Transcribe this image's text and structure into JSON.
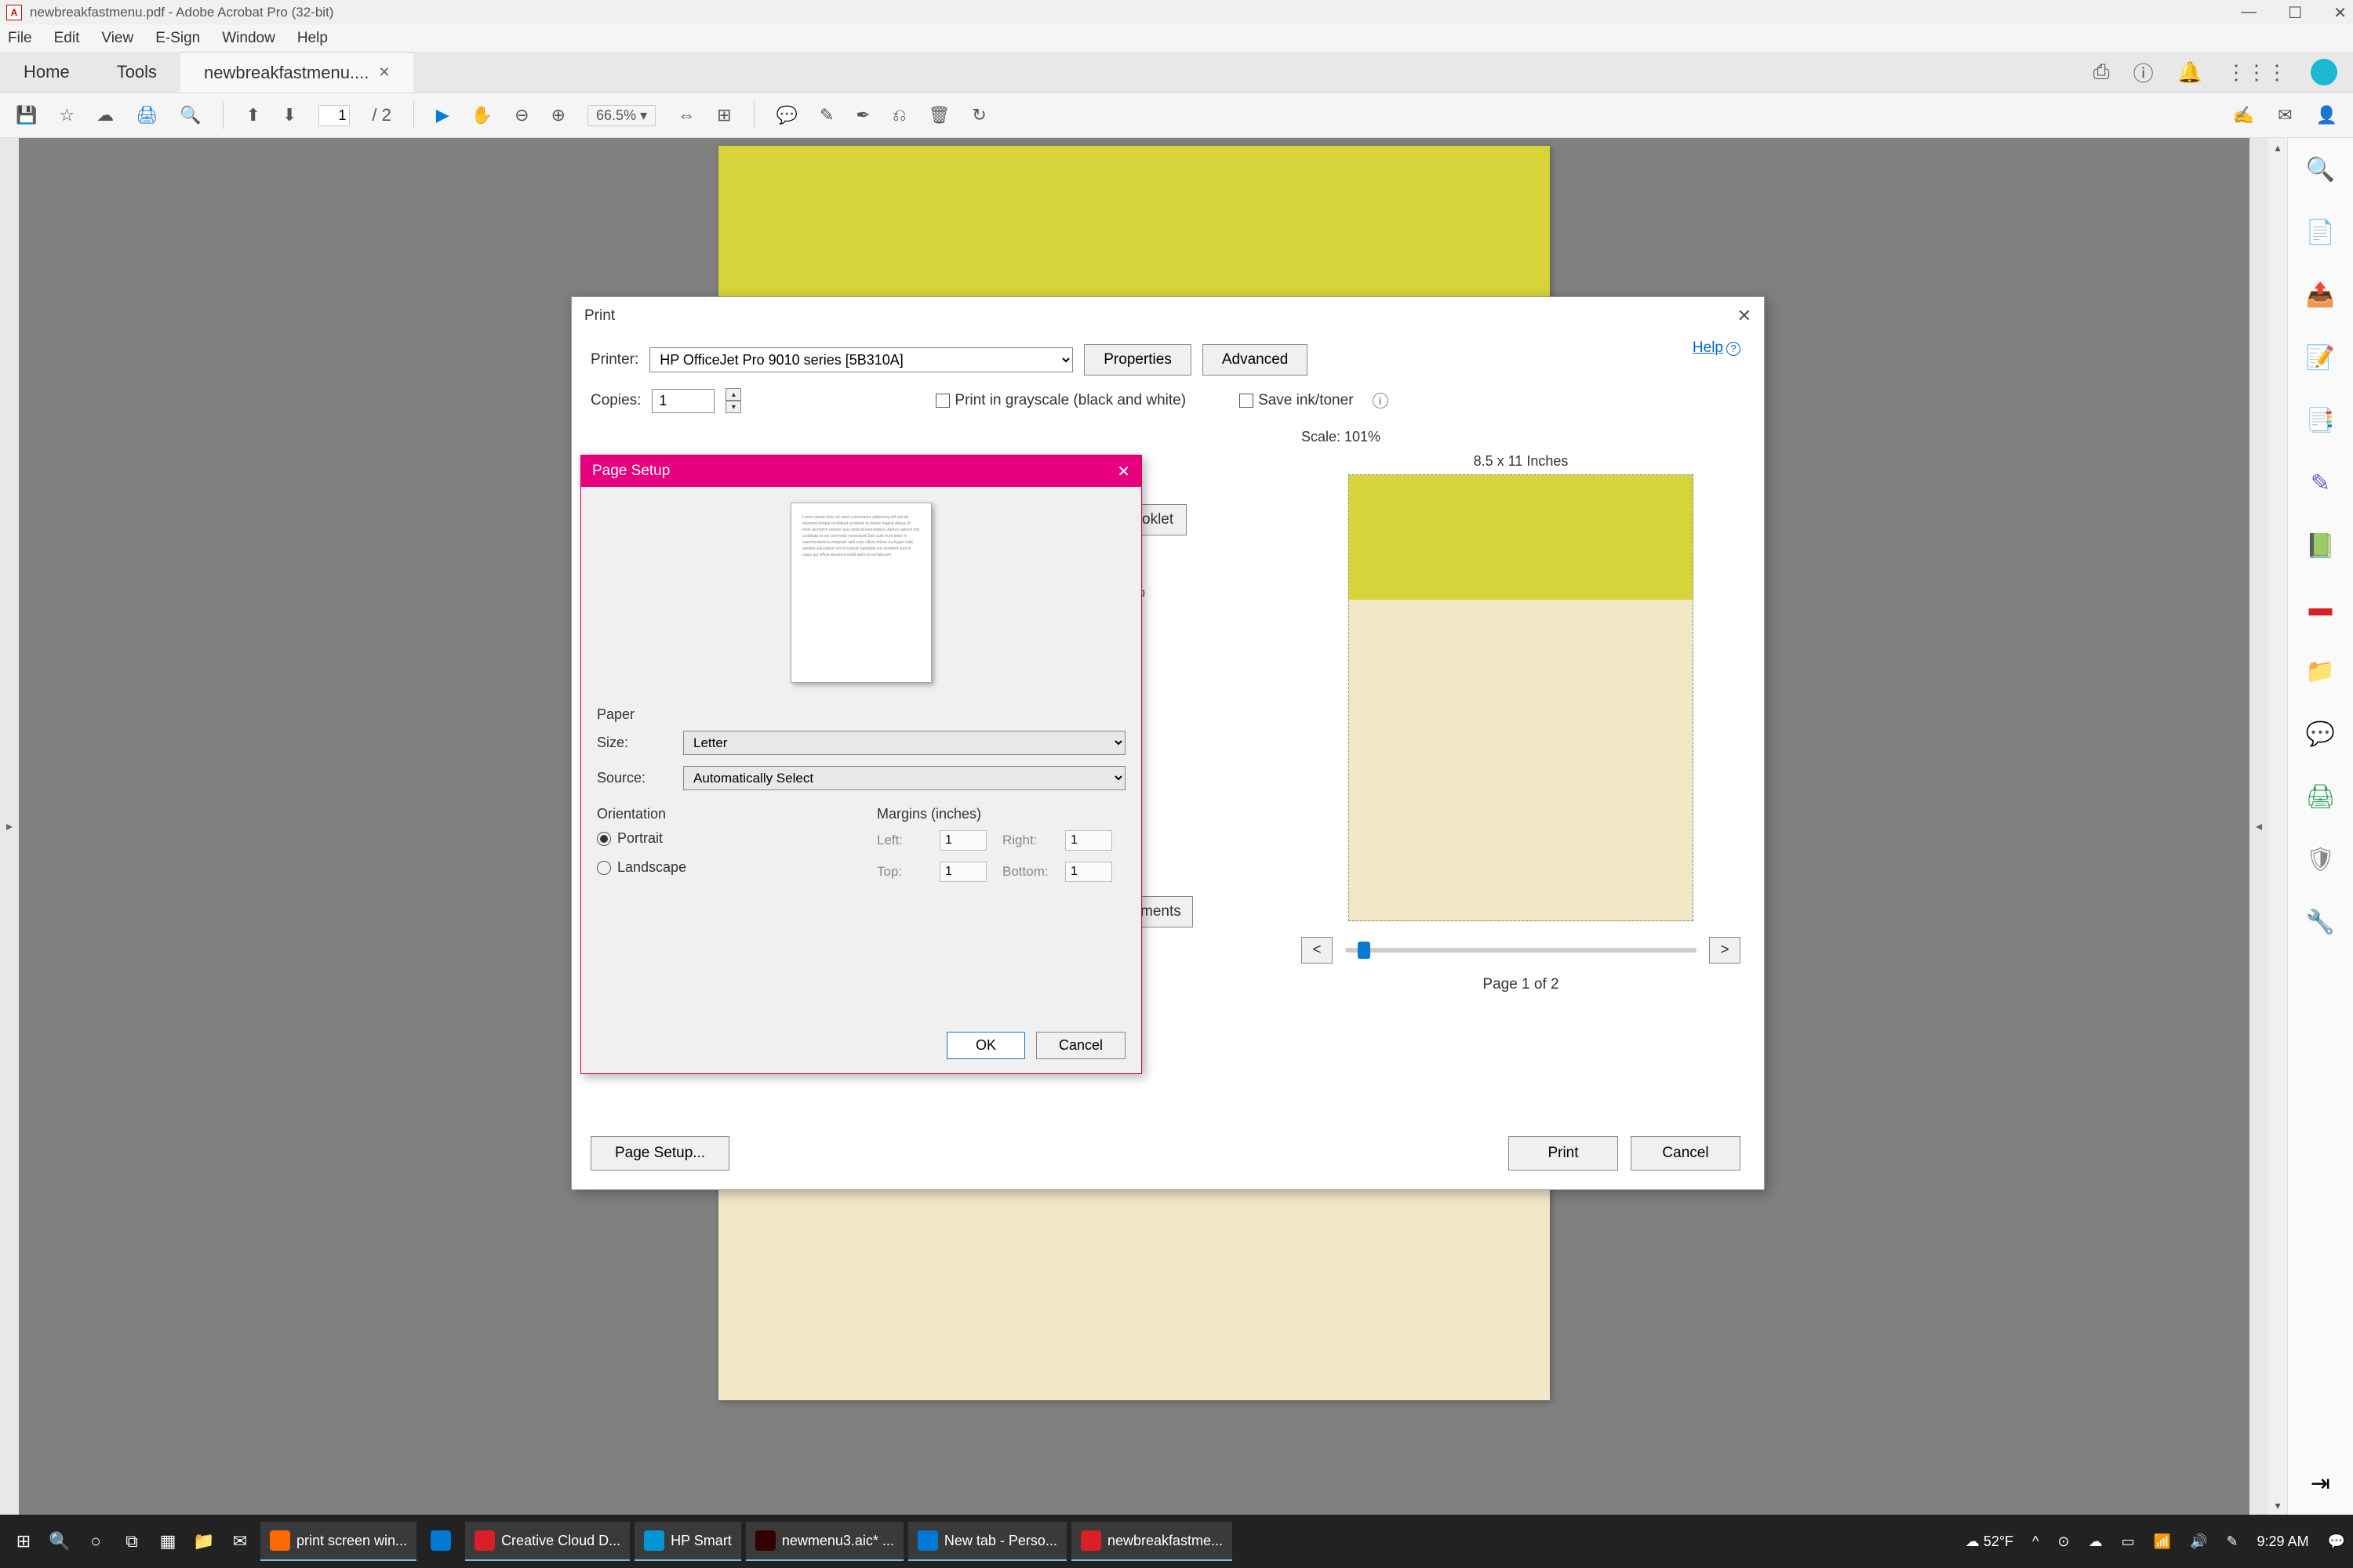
{
  "titlebar": {
    "text": "newbreakfastmenu.pdf - Adobe Acrobat Pro (32-bit)"
  },
  "menubar": {
    "items": [
      "File",
      "Edit",
      "View",
      "E-Sign",
      "Window",
      "Help"
    ]
  },
  "tabs": {
    "home": "Home",
    "tools": "Tools",
    "doc": "newbreakfastmenu...."
  },
  "toolbar": {
    "page_current": "1",
    "page_total": "/ 2",
    "zoom": "66.5%"
  },
  "print": {
    "title": "Print",
    "printer_label": "Printer:",
    "printer_value": "HP OfficeJet Pro 9010 series [5B310A]",
    "properties": "Properties",
    "advanced": "Advanced",
    "help": "Help",
    "copies_label": "Copies:",
    "copies_value": "1",
    "grayscale": "Print in grayscale (black and white)",
    "saveink": "Save ink/toner",
    "booklet_partial": "oklet",
    "ments_partial": "ments",
    "pct_partial": "%",
    "scale": "Scale: 101%",
    "dims": "8.5 x 11 Inches",
    "prev": "<",
    "next": ">",
    "page_of": "Page 1 of 2",
    "page_setup_btn": "Page Setup...",
    "print_btn": "Print",
    "cancel_btn": "Cancel"
  },
  "pagesetup": {
    "title": "Page Setup",
    "paper": "Paper",
    "size_label": "Size:",
    "size_value": "Letter",
    "source_label": "Source:",
    "source_value": "Automatically Select",
    "orientation": "Orientation",
    "portrait": "Portrait",
    "landscape": "Landscape",
    "margins": "Margins (inches)",
    "left": "Left:",
    "right": "Right:",
    "top": "Top:",
    "bottom": "Bottom:",
    "margin_val": "1",
    "ok": "OK",
    "cancel": "Cancel"
  },
  "taskbar": {
    "items": [
      {
        "label": "print screen win...",
        "color": "#ff6a00"
      },
      {
        "label": "",
        "color": "#0078d4"
      },
      {
        "label": "Creative Cloud D...",
        "color": "#da1f26"
      },
      {
        "label": "HP Smart",
        "color": "#0096d6"
      },
      {
        "label": "newmenu3.aic* ...",
        "color": "#330000"
      },
      {
        "label": "New tab - Perso...",
        "color": "#0078d4"
      },
      {
        "label": "newbreakfastme...",
        "color": "#da1f26"
      }
    ],
    "weather": "52°F",
    "time": "9:29 AM"
  },
  "colors": {
    "magenta": "#e6007e",
    "acrobat_red": "#da1f26",
    "blue": "#0a7bd4"
  }
}
